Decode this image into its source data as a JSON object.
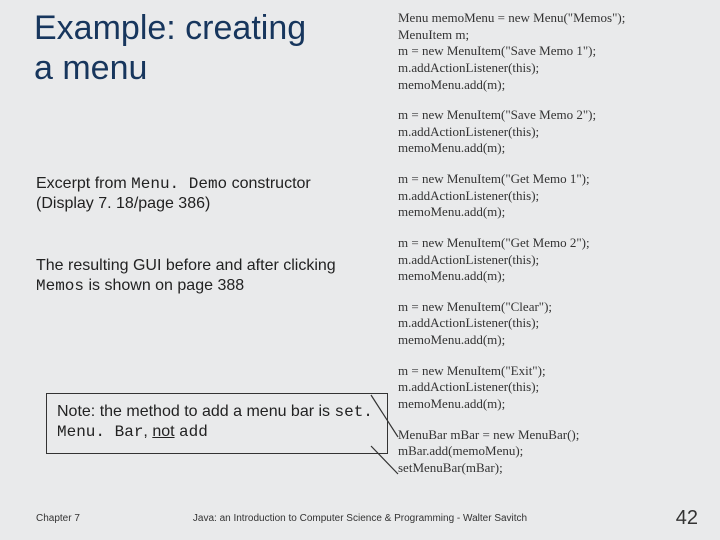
{
  "title": "Example: creating a menu",
  "excerpt": {
    "pre": "Excerpt from ",
    "mono": "Menu. Demo",
    "post": " constructor (Display 7. 18/page 386)"
  },
  "result": {
    "pre": "The resulting GUI before and after clicking ",
    "mono": "Memos",
    "post": " is shown on page 388"
  },
  "note": {
    "pre": "Note: the method to add a menu bar is ",
    "mono1": "set. Menu. Bar",
    "mid": ", ",
    "underlined": "not",
    "space": " ",
    "mono2": "add"
  },
  "code_blocks": [
    [
      "Menu memoMenu = new Menu(\"Memos\");",
      "MenuItem m;",
      "m = new MenuItem(\"Save Memo 1\");",
      "m.addActionListener(this);",
      "memoMenu.add(m);"
    ],
    [
      "m = new MenuItem(\"Save Memo 2\");",
      "m.addActionListener(this);",
      "memoMenu.add(m);"
    ],
    [
      "m = new MenuItem(\"Get Memo 1\");",
      "m.addActionListener(this);",
      "memoMenu.add(m);"
    ],
    [
      "m = new MenuItem(\"Get Memo 2\");",
      "m.addActionListener(this);",
      "memoMenu.add(m);"
    ],
    [
      "m = new MenuItem(\"Clear\");",
      "m.addActionListener(this);",
      "memoMenu.add(m);"
    ],
    [
      "m = new MenuItem(\"Exit\");",
      "m.addActionListener(this);",
      "memoMenu.add(m);"
    ],
    [
      "MenuBar mBar = new MenuBar();",
      "mBar.add(memoMenu);",
      "setMenuBar(mBar);"
    ]
  ],
  "footer": {
    "left": "Chapter 7",
    "center": "Java: an Introduction to Computer Science & Programming - Walter Savitch",
    "right": "42"
  }
}
